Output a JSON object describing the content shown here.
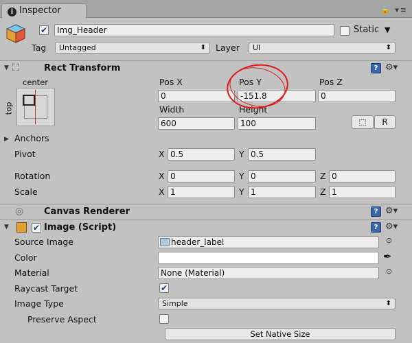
{
  "tab": {
    "title": "Inspector",
    "info_glyph": "i",
    "controls": "🔒 ▾≡"
  },
  "object": {
    "active": true,
    "name": "Img_Header",
    "static_label": "Static",
    "static_checked": false,
    "tag_label": "Tag",
    "tag_value": "Untagged",
    "layer_label": "Layer",
    "layer_value": "UI"
  },
  "rect_transform": {
    "title": "Rect Transform",
    "anchor_h": "center",
    "anchor_v": "top",
    "pos_x_label": "Pos X",
    "pos_x": "0",
    "pos_y_label": "Pos Y",
    "pos_y": "-151.8",
    "pos_z_label": "Pos Z",
    "pos_z": "0",
    "width_label": "Width",
    "width": "600",
    "height_label": "Height",
    "height": "100",
    "blueprint_btn": "⬚",
    "raw_btn": "R",
    "anchors_label": "Anchors",
    "pivot_label": "Pivot",
    "pivot_x": "0.5",
    "pivot_y": "0.5",
    "rotation_label": "Rotation",
    "rot_x": "0",
    "rot_y": "0",
    "rot_z": "0",
    "scale_label": "Scale",
    "scale_x": "1",
    "scale_y": "1",
    "scale_z": "1",
    "x": "X",
    "y": "Y",
    "z": "Z"
  },
  "canvas_renderer": {
    "title": "Canvas Renderer"
  },
  "image": {
    "title": "Image (Script)",
    "enabled": true,
    "source_image_label": "Source Image",
    "source_image": "header_label",
    "color_label": "Color",
    "color_value": "#ffffff",
    "material_label": "Material",
    "material": "None (Material)",
    "raycast_label": "Raycast Target",
    "raycast_checked": true,
    "image_type_label": "Image Type",
    "image_type": "Simple",
    "preserve_label": "Preserve Aspect",
    "preserve_checked": false,
    "native_size_btn": "Set Native Size"
  },
  "colors": {
    "panel": "#c2c2c2",
    "accent": "#3b67a8",
    "annotation": "#e01818"
  }
}
